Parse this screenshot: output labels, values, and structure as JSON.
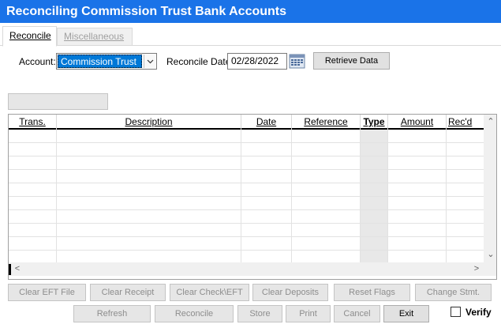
{
  "window": {
    "title": "Reconciling Commission Trust Bank Accounts"
  },
  "tabs": [
    {
      "label": "Reconcile",
      "active": true
    },
    {
      "label": "Miscellaneous",
      "active": false
    }
  ],
  "filters": {
    "account_label": "Account:",
    "account_value": "Commission Trust",
    "date_label": "Reconcile Date:",
    "date_value": "02/28/2022",
    "retrieve_label": "Retrieve Data"
  },
  "grid": {
    "columns": [
      "Trans.",
      "Description",
      "Date",
      "Reference",
      "Type",
      "Amount",
      "Rec'd"
    ],
    "rows": []
  },
  "actions_row1": {
    "clear_eft": "Clear EFT File",
    "clear_receipt": "Clear Receipt",
    "clear_check_eft": "Clear Check\\EFT",
    "clear_deposits": "Clear Deposits",
    "reset_flags": "Reset Flags",
    "change_stmt": "Change Stmt."
  },
  "actions_row2": {
    "refresh": "Refresh",
    "reconcile": "Reconcile",
    "store": "Store",
    "print": "Print",
    "cancel": "Cancel",
    "exit": "Exit",
    "verify": "Verify"
  },
  "colors": {
    "titlebar": "#1a73e8",
    "selection": "#0078d7"
  }
}
